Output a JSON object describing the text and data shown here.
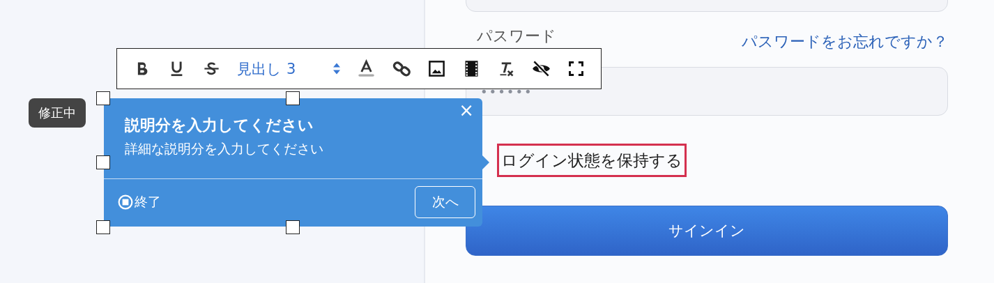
{
  "login_form": {
    "password_label": "パスワード",
    "forgot_link": "パスワードをお忘れですか？",
    "password_value": "••••••",
    "remember_label": "ログイン状態を保持する",
    "sign_in_button": "サインイン"
  },
  "editor_toolbar": {
    "heading_select": "見出し 3"
  },
  "status_badge": "修正中",
  "tour_popup": {
    "title": "説明分を入力してください",
    "description": "詳細な説明分を入力してください",
    "close": "×",
    "end_button": "終了",
    "next_button": "次へ"
  }
}
